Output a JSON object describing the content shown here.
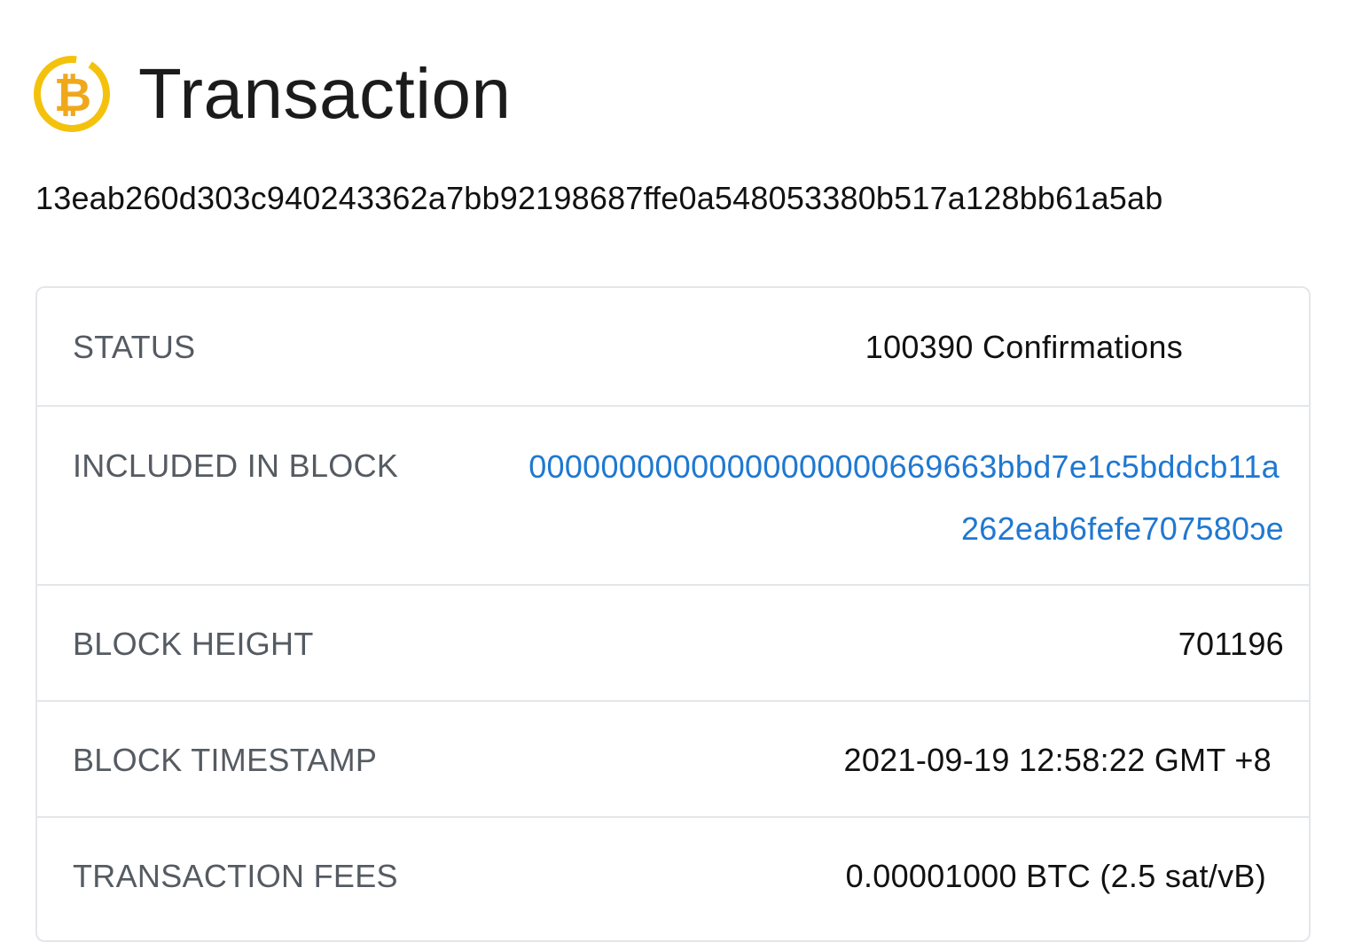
{
  "header": {
    "title": "Transaction",
    "logo_icon": "bitcoin-logo-icon",
    "logo_color": "#F4C20D"
  },
  "transaction": {
    "hash": "13eab260d303c940243362a7bb92198687ffe0a548053380b517a128bb61a5ab"
  },
  "details": {
    "status": {
      "label": "STATUS",
      "value": "100390 Confirmations"
    },
    "included_in_block": {
      "label": "INCLUDED IN BLOCK",
      "value_line1": "00000000000000000000669663bbd7e1c5bddcb11a",
      "value_line2": "262eab6fefe707580ᴐe",
      "link_color": "#1F78D1"
    },
    "block_height": {
      "label": "BLOCK HEIGHT",
      "value": "701196"
    },
    "block_timestamp": {
      "label": "BLOCK TIMESTAMP",
      "value": "2021-09-19 12:58:22 GMT +8"
    },
    "transaction_fees": {
      "label": "TRANSACTION FEES",
      "value": "0.00001000 BTC (2.5 sat/vB)"
    }
  }
}
